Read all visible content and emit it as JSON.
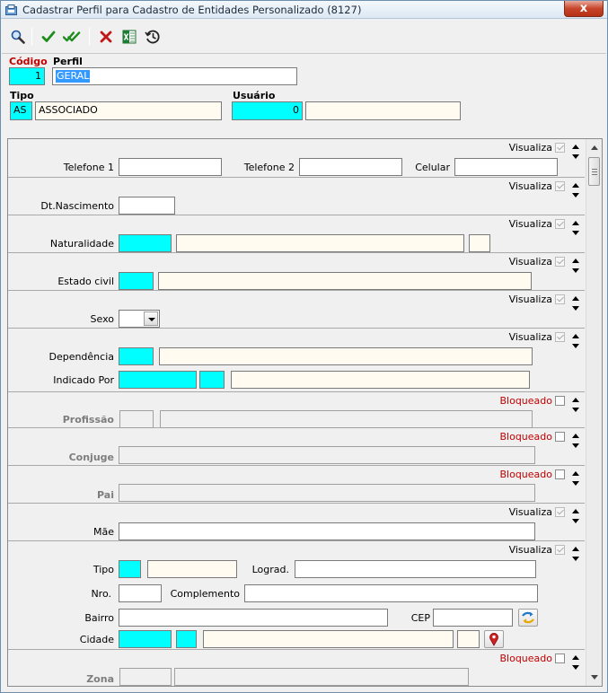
{
  "window": {
    "title": "Cadastrar Perfil para Cadastro de Entidades Personalizado (8127)",
    "close": "x"
  },
  "toolbar": {
    "buttons": [
      {
        "icon": "magnifier-icon",
        "action": "search"
      },
      {
        "icon": "check-icon",
        "action": "confirm"
      },
      {
        "icon": "double-check-icon",
        "action": "confirm-all"
      },
      {
        "icon": "red-x-icon",
        "action": "cancel"
      },
      {
        "icon": "excel-icon",
        "action": "export"
      },
      {
        "icon": "history-icon",
        "action": "history"
      }
    ]
  },
  "header": {
    "codigo": {
      "label": "Código",
      "value": "1"
    },
    "perfil": {
      "label": "Perfil",
      "value": "GERAL"
    },
    "tipo": {
      "label": "Tipo",
      "code": "AS",
      "description": "ASSOCIADO"
    },
    "usuario": {
      "label": "Usuário",
      "value": "0",
      "name": ""
    }
  },
  "sections": {
    "telefones": {
      "flag": "Visualiza",
      "checked": true,
      "telefone1": "Telefone 1",
      "telefone2": "Telefone 2",
      "celular": "Celular"
    },
    "nascimento": {
      "flag": "Visualiza",
      "checked": true,
      "label": "Dt.Nascimento"
    },
    "naturalidade": {
      "flag": "Visualiza",
      "checked": true,
      "label": "Naturalidade"
    },
    "estado_civil": {
      "flag": "Visualiza",
      "checked": true,
      "label": "Estado civil"
    },
    "sexo": {
      "flag": "Visualiza",
      "checked": true,
      "label": "Sexo",
      "value": ""
    },
    "dependencia": {
      "flag": "Visualiza",
      "checked": true,
      "label": "Dependência",
      "indicado_label": "Indicado Por"
    },
    "profissao": {
      "flag": "Bloqueado",
      "checked": false,
      "label": "Profissão"
    },
    "conjuge": {
      "flag": "Bloqueado",
      "checked": false,
      "label": "Conjuge"
    },
    "pai": {
      "flag": "Bloqueado",
      "checked": false,
      "label": "Pai"
    },
    "mae": {
      "flag": "Visualiza",
      "checked": true,
      "label": "Mãe"
    },
    "endereco": {
      "flag": "Visualiza",
      "checked": true,
      "tipo": "Tipo",
      "lograd": "Lograd.",
      "nro": "Nro.",
      "complemento": "Complemento",
      "bairro": "Bairro",
      "cep": "CEP",
      "cidade": "Cidade"
    },
    "zona": {
      "flag": "Bloqueado",
      "checked": false,
      "label": "Zona"
    }
  },
  "colors": {
    "required": "#00ffff",
    "readonly": "#fffbf0",
    "blocked_text": "#c00000"
  }
}
